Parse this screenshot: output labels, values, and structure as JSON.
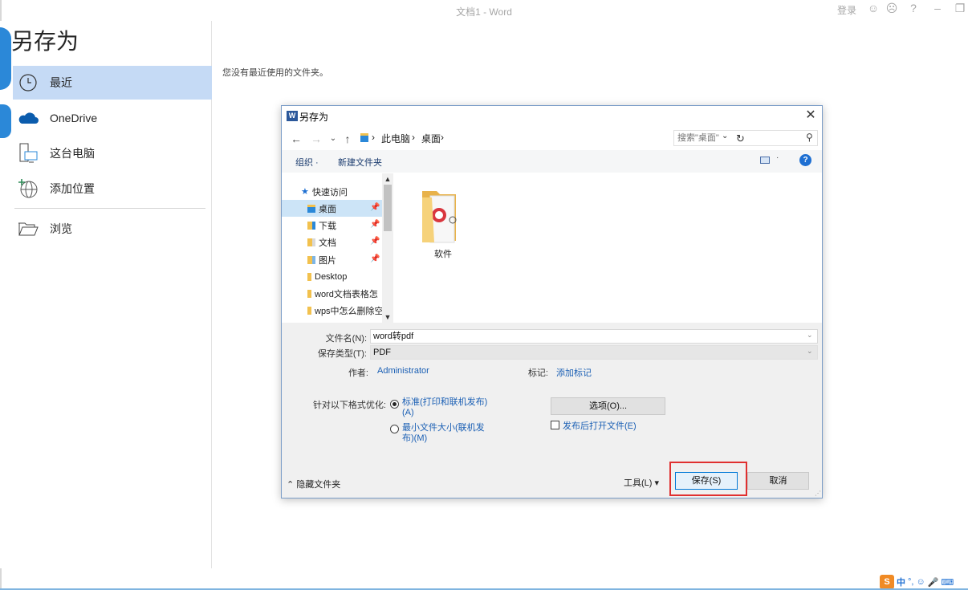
{
  "window": {
    "title": "文档1  -  Word",
    "signin": "登录",
    "controls": [
      "smile-icon",
      "frown-icon",
      "help-icon",
      "minimize-icon",
      "restore-icon"
    ]
  },
  "backstage": {
    "title": "另存为",
    "nav": [
      {
        "label": "最近",
        "icon": "clock-icon",
        "selected": true
      },
      {
        "label": "OneDrive",
        "icon": "cloud-icon"
      },
      {
        "label": "这台电脑",
        "icon": "computer-icon"
      },
      {
        "label": "添加位置",
        "icon": "globe-add-icon"
      },
      {
        "label": "浏览",
        "icon": "folder-open-icon"
      }
    ],
    "no_recent": "您没有最近使用的文件夹。"
  },
  "dialog": {
    "title": "另存为",
    "breadcrumb": [
      "此电脑",
      "桌面"
    ],
    "search_placeholder": "搜索\"桌面\"",
    "toolbar": {
      "organize": "组织 ·",
      "new_folder": "新建文件夹"
    },
    "tree": [
      {
        "label": "快速访问",
        "icon": "star-icon"
      },
      {
        "label": "桌面",
        "icon": "desktop-folder-icon",
        "pinned": true,
        "selected": true
      },
      {
        "label": "下载",
        "icon": "download-folder-icon",
        "pinned": true
      },
      {
        "label": "文档",
        "icon": "documents-folder-icon",
        "pinned": true
      },
      {
        "label": "图片",
        "icon": "pictures-folder-icon",
        "pinned": true
      },
      {
        "label": "Desktop",
        "icon": "folder-icon"
      },
      {
        "label": "word文档表格怎",
        "icon": "folder-icon"
      },
      {
        "label": "wps中怎么删除空",
        "icon": "folder-icon"
      }
    ],
    "files": [
      {
        "name": "软件",
        "icon": "folder-with-app-icon"
      }
    ],
    "form": {
      "filename_label": "文件名(N):",
      "filename_value": "word转pdf",
      "filetype_label": "保存类型(T):",
      "filetype_value": "PDF",
      "author_label": "作者:",
      "author_value": "Administrator",
      "tags_label": "标记:",
      "tags_value": "添加标记",
      "optimize_label": "针对以下格式优化:",
      "option_standard": "标准(打印和联机发布)(A)",
      "option_minimum": "最小文件大小(联机发布)(M)",
      "standard_selected": true,
      "options_button": "选项(O)...",
      "open_after_publish": "发布后打开文件(E)",
      "open_after_publish_checked": false
    },
    "footer": {
      "hide_folders": "隐藏文件夹",
      "tools": "工具(L)",
      "save": "保存(S)",
      "cancel": "取消"
    }
  },
  "ime": {
    "logo": "S",
    "mode": "中"
  },
  "colors": {
    "accent": "#2b579a",
    "selected_nav": "#c5daf5",
    "highlight": "#e03030",
    "link": "#1a5fb4"
  }
}
